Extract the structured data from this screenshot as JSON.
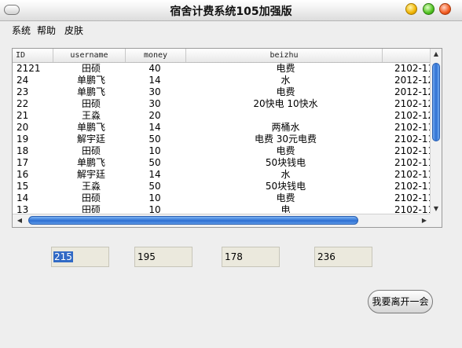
{
  "window": {
    "title": "宿舍计费系统105加强版"
  },
  "menu": [
    "系统",
    "帮助",
    "皮肤"
  ],
  "table": {
    "columns": [
      "ID",
      "username",
      "money",
      "beizhu",
      ""
    ],
    "rows": [
      [
        "2121",
        "田硕",
        "40",
        "电费",
        "2102-11"
      ],
      [
        "24",
        "单鹏飞",
        "14",
        "水",
        "2012-12"
      ],
      [
        "23",
        "单鹏飞",
        "30",
        "电费",
        "2012-12"
      ],
      [
        "22",
        "田硕",
        "30",
        "20快电 10快水",
        "2102-12"
      ],
      [
        "21",
        "王淼",
        "20",
        "",
        "2102-12"
      ],
      [
        "20",
        "单鹏飞",
        "14",
        "两桶水",
        "2102-11"
      ],
      [
        "19",
        "解宇廷",
        "50",
        "电费  30元电费",
        "2102-11"
      ],
      [
        "18",
        "田硕",
        "10",
        "电费",
        "2102-11"
      ],
      [
        "17",
        "单鹏飞",
        "50",
        "50块钱电",
        "2102-11"
      ],
      [
        "16",
        "解宇廷",
        "14",
        "水",
        "2102-11"
      ],
      [
        "15",
        "王淼",
        "50",
        "50块钱电",
        "2102-11"
      ],
      [
        "14",
        "田硕",
        "10",
        "电费",
        "2102-11"
      ],
      [
        "13",
        "田硕",
        "10",
        "电",
        "2102-11"
      ]
    ]
  },
  "fields": [
    "215",
    "195",
    "178",
    "236"
  ],
  "buttons": {
    "leave": "我要离开一会"
  },
  "colors": {
    "selection": "#316ac5",
    "scroll_thumb": "#2d6fd2"
  }
}
